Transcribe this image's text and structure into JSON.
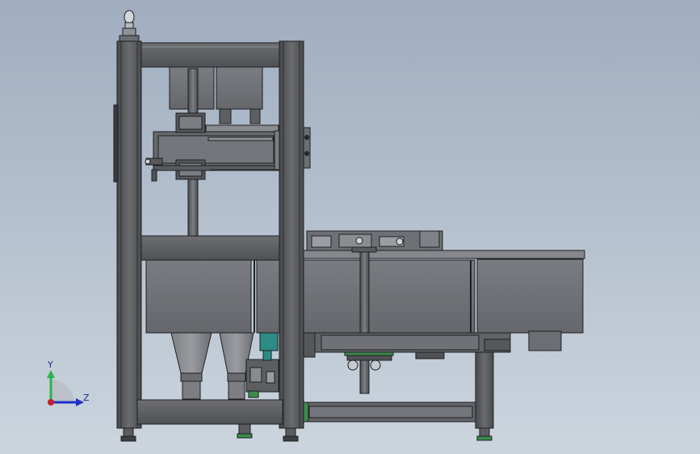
{
  "viewport": {
    "background_top": "#9fadbf",
    "background_bottom": "#ccd5de"
  },
  "model": {
    "frame_color": "#5f6063",
    "frame_edge": "#1e1f21",
    "panel_color": "#707277",
    "accent_teal": "#2c8c86",
    "accent_green": "#3b8c4a"
  },
  "triad": {
    "y_label": "Y",
    "z_label": "Z",
    "y_color": "#2bb34a",
    "z_color": "#1f2fc8",
    "origin_color": "#c41e2a"
  }
}
